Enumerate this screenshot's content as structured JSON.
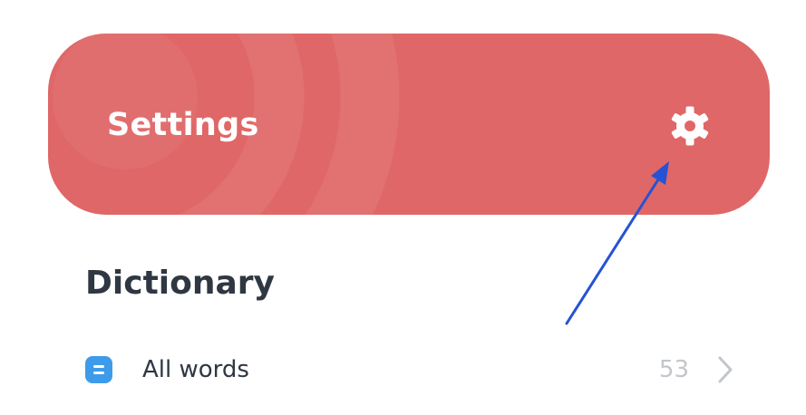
{
  "header": {
    "title": "Settings",
    "icon": "gear-icon",
    "background_color": "#e06767",
    "text_color": "#ffffff"
  },
  "annotation": {
    "type": "arrow",
    "color": "#2553d4",
    "points_to": "gear-icon"
  },
  "dictionary": {
    "title": "Dictionary",
    "items": [
      {
        "label": "All words",
        "count": "53",
        "icon": "list-icon",
        "icon_color": "#3d9bea",
        "trailing_icon": "chevron-right-icon"
      }
    ]
  }
}
